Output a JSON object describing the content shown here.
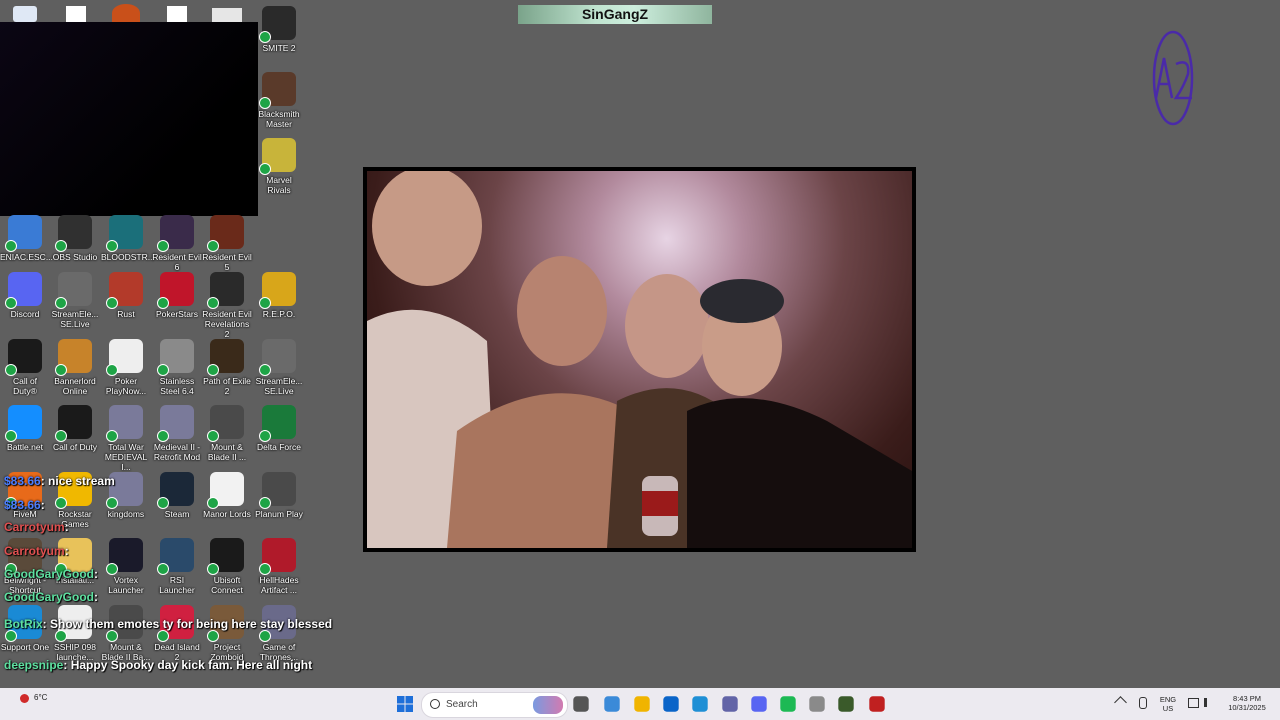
{
  "overlay": {
    "title": "SinGangZ"
  },
  "desktop_icons": [
    {
      "label": "SMITE 2",
      "color": "#2a2a2a"
    },
    {
      "label": "Blacksmith Master",
      "color": "#5a3a2a"
    },
    {
      "label": "Marvel Rivals",
      "color": "#c8b43a"
    },
    {
      "label": "ENIAC.ESC...",
      "color": "#3a7bd5"
    },
    {
      "label": "OBS Studio",
      "color": "#303030"
    },
    {
      "label": "BLOODSTR...",
      "color": "#1b6f7a"
    },
    {
      "label": "Resident Evil 6",
      "color": "#3a2b4a"
    },
    {
      "label": "Resident Evil 5",
      "color": "#6a2a1a"
    },
    {
      "label": "Discord",
      "color": "#5865f2"
    },
    {
      "label": "StreamEle... SE.Live",
      "color": "#6a6a6a"
    },
    {
      "label": "Rust",
      "color": "#b33a2a"
    },
    {
      "label": "PokerStars",
      "color": "#c0152a"
    },
    {
      "label": "Resident Evil Revelations 2",
      "color": "#2a2a2a"
    },
    {
      "label": "R.E.P.O.",
      "color": "#d8a61a"
    },
    {
      "label": "Call of Duty®",
      "color": "#1a1a1a"
    },
    {
      "label": "Bannerlord Online",
      "color": "#c7832a"
    },
    {
      "label": "Poker PlayNow...",
      "color": "#eeeeee"
    },
    {
      "label": "Stainless Steel 6.4",
      "color": "#8a8a8a"
    },
    {
      "label": "Path of Exile 2",
      "color": "#3a2a1a"
    },
    {
      "label": "StreamEle... SE.Live",
      "color": "#6a6a6a"
    },
    {
      "label": "Battle.net",
      "color": "#148eff"
    },
    {
      "label": "Call of Duty",
      "color": "#1a1a1a"
    },
    {
      "label": "Total War MEDIEVAL I...",
      "color": "#7a7a9a"
    },
    {
      "label": "Medieval II - Retrofit Mod",
      "color": "#7a7a9a"
    },
    {
      "label": "Mount & Blade II ...",
      "color": "#4a4a4a"
    },
    {
      "label": "Delta Force",
      "color": "#1a7a3a"
    },
    {
      "label": "FiveM",
      "color": "#e86a1a"
    },
    {
      "label": "Rockstar Games",
      "color": "#f0b800"
    },
    {
      "label": "kingdoms",
      "color": "#7a7a9a"
    },
    {
      "label": "Steam",
      "color": "#1b2838"
    },
    {
      "label": "Manor Lords",
      "color": "#f2f2f2"
    },
    {
      "label": "Planum Play",
      "color": "#4a4a4a"
    },
    {
      "label": "Bellwright - Shortcut",
      "color": "#5a4a3a"
    },
    {
      "label": "Installati...",
      "color": "#e8c25a"
    },
    {
      "label": "Vortex Launcher",
      "color": "#1a1a2a"
    },
    {
      "label": "RSI Launcher",
      "color": "#2a4a6a"
    },
    {
      "label": "Ubisoft Connect",
      "color": "#1a1a1a"
    },
    {
      "label": "HellHades Artifact ...",
      "color": "#b01a2a"
    },
    {
      "label": "Support One",
      "color": "#1a8ad5"
    },
    {
      "label": "SSHIP 098 launche...",
      "color": "#eeeeee"
    },
    {
      "label": "Mount & Blade II Ba...",
      "color": "#4a4a4a"
    },
    {
      "label": "Dead Island 2",
      "color": "#d02040"
    },
    {
      "label": "Project Zomboid",
      "color": "#7a5a3a"
    },
    {
      "label": "Game of Thrones...",
      "color": "#6a6a8a"
    }
  ],
  "chat": [
    {
      "user": "$83.66",
      "text": ": nice stream",
      "user_color": "blue"
    },
    {
      "user": "$83.66",
      "text": ":",
      "user_color": "blue"
    },
    {
      "user": "Carrotyum",
      "text": ":",
      "user_color": "red"
    },
    {
      "user": "Carrotyum",
      "text": ":",
      "user_color": "red"
    },
    {
      "user": "GoodGaryGood",
      "text": ":",
      "user_color": "green"
    },
    {
      "user": "GoodGaryGood",
      "text": ":",
      "user_color": "green"
    },
    {
      "user": "BotRix",
      "text": ": Show them emotes ty for being here stay blessed",
      "user_color": "green"
    },
    {
      "user": "deepsnipe",
      "text": ": Happy Spooky day kick fam. Here all night",
      "user_color": "green"
    },
    {
      "user": "deepsnipe",
      "text": "",
      "user_color": "green"
    }
  ],
  "taskbar": {
    "weather": "6°C",
    "search_placeholder": "Search",
    "lang_line1": "ENG",
    "lang_line2": "US",
    "time": "8:43 PM",
    "date": "10/31/2025",
    "app_colors": [
      "#2a6fdb",
      "#555555",
      "#3b8ad8",
      "#f0b400",
      "#0a64c8",
      "#1e8fd5",
      "#6264a7",
      "#5865f2",
      "#1db954",
      "#8a8a8a",
      "#3a5a2a",
      "#c02020"
    ]
  }
}
